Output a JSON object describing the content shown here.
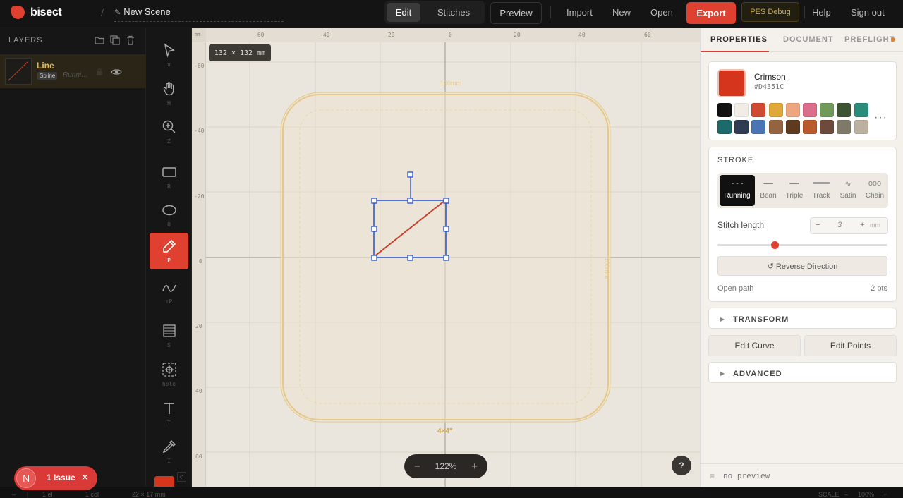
{
  "app": {
    "name": "bisect",
    "scene_name": "New Scene"
  },
  "topbar": {
    "modes": [
      "Edit",
      "Stitches"
    ],
    "active_mode": "Edit",
    "preview": "Preview",
    "import": "Import",
    "new": "New",
    "open": "Open",
    "export": "Export",
    "pes_debug": "PES Debug",
    "help": "Help",
    "sign_out": "Sign out"
  },
  "layers": {
    "title": "LAYERS",
    "items": [
      {
        "name": "Line",
        "badge": "Spline",
        "stitch": "Runni…"
      }
    ]
  },
  "tools": [
    {
      "name": "select",
      "hotkey": "V"
    },
    {
      "name": "hand",
      "hotkey": "H"
    },
    {
      "name": "zoom",
      "hotkey": "Z"
    },
    {
      "name": "rectangle",
      "hotkey": "R"
    },
    {
      "name": "ellipse",
      "hotkey": "O"
    },
    {
      "name": "pen",
      "hotkey": "P",
      "active": true
    },
    {
      "name": "curve",
      "hotkey": "⇧P"
    },
    {
      "name": "fill",
      "hotkey": "S"
    },
    {
      "name": "hole",
      "hotkey": "hole"
    },
    {
      "name": "text",
      "hotkey": "T"
    },
    {
      "name": "eyedropper",
      "hotkey": "I"
    }
  ],
  "canvas": {
    "dimension_tip": "132 × 132 mm",
    "ruler_top": [
      "-60",
      "-40",
      "-20",
      "0",
      "20",
      "40",
      "60"
    ],
    "ruler_left": [
      "-60",
      "-40",
      "-20",
      "0",
      "20",
      "40",
      "60"
    ],
    "ruler_corner": "mm",
    "hoop_top_label": "100mm",
    "hoop_right_label": "100mm",
    "hoop_size_label": "4×4\"",
    "zoom": "122%",
    "zoom_minus": "−",
    "zoom_plus": "+",
    "help": "?"
  },
  "properties": {
    "tabs": [
      "PROPERTIES",
      "DOCUMENT",
      "PREFLIGHT"
    ],
    "active_tab": "PROPERTIES",
    "color": {
      "name": "Crimson",
      "hex": "#D4351C"
    },
    "palette": [
      "#111111",
      "#f1ede6",
      "#d04a32",
      "#e0a73a",
      "#eda67f",
      "#da6e8c",
      "#6f9a5a",
      "#3d5432",
      "#2a8c7a",
      "#1c6a6a",
      "#2f3c52",
      "#4b74b5",
      "#94633f",
      "#5e3a1e",
      "#b85a2c",
      "#6e4a3a",
      "#7f7a68",
      "#bcb1a0"
    ],
    "palette_more": "···",
    "stroke": {
      "title": "STROKE",
      "types": [
        {
          "label": "Running",
          "glyph": "- - -",
          "active": true
        },
        {
          "label": "Bean",
          "glyph": "━━"
        },
        {
          "label": "Triple",
          "glyph": "━━"
        },
        {
          "label": "Track",
          "glyph": "═══"
        },
        {
          "label": "Satin",
          "glyph": "∿"
        },
        {
          "label": "Chain",
          "glyph": "ooo"
        }
      ],
      "stitch_length_label": "Stitch length",
      "stitch_length_value": "3",
      "stitch_length_unit": "mm",
      "stitch_length_minus": "−",
      "stitch_length_plus": "+",
      "slider_fraction": 0.34,
      "reverse_direction": "↺ Reverse Direction",
      "path_type": "Open path",
      "points": "2 pts"
    },
    "transform_title": "TRANSFORM",
    "edit_curve": "Edit Curve",
    "edit_points": "Edit Points",
    "advanced_title": "ADVANCED",
    "no_preview": "no preview"
  },
  "statusbar": {
    "elements": "1 el",
    "color_count": "1 col",
    "size": "22 × 17 mm",
    "scale_label": "SCALE",
    "scale_value": "100%"
  },
  "issue_toast": {
    "avatar": "N",
    "text": "1 Issue",
    "close": "✕"
  }
}
